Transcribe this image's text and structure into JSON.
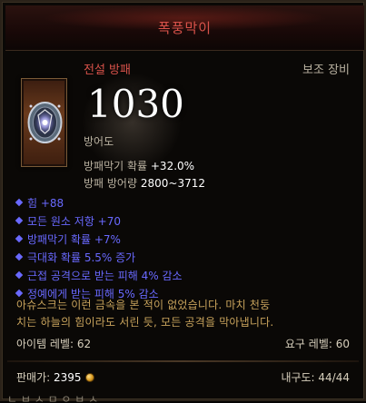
{
  "item": {
    "name": "폭풍막이",
    "type": "전설 방패",
    "slot": "보조 장비",
    "armor_value": "1030",
    "armor_label": "방어도",
    "block_chance_label": "방패막기 확률 ",
    "block_chance_value": "+32.0%",
    "block_amount_label": "방패 방어량 ",
    "block_amount_value": "2800~3712"
  },
  "affixes": [
    "힘 +88",
    "모든 원소 저항 +70",
    "방패막기 확률 +7%",
    "극대화 확률 5.5% 증가",
    "근접 공격으로 받는 피해 4% 감소",
    "정예에게 받는 피해 5% 감소"
  ],
  "flavor_text": {
    "line1": "아슈스크는 이런 금속을 본 적이 없었습니다. 마치 천둥",
    "line2": "치는 하늘의 힘이라도 서린 듯, 모든 공격을 막아냅니다."
  },
  "requirements": {
    "item_level": "아이템 레벨: 62",
    "required_level": "요구 레벨: 60"
  },
  "footer": {
    "sell_label": "판매가: ",
    "sell_value": "2395",
    "durability": "내구도: 44/44",
    "cut_text": "ㄴ ㅂ ㅅ ㅁ ㅇ ㅂ ㅅ"
  },
  "icons": {
    "item_icon": "shield-icon",
    "currency_icon": "gold-coin-icon"
  },
  "colors": {
    "legendary": "#d8524a",
    "magic_affix": "#6969ff",
    "flavor": "#c8a35c"
  }
}
